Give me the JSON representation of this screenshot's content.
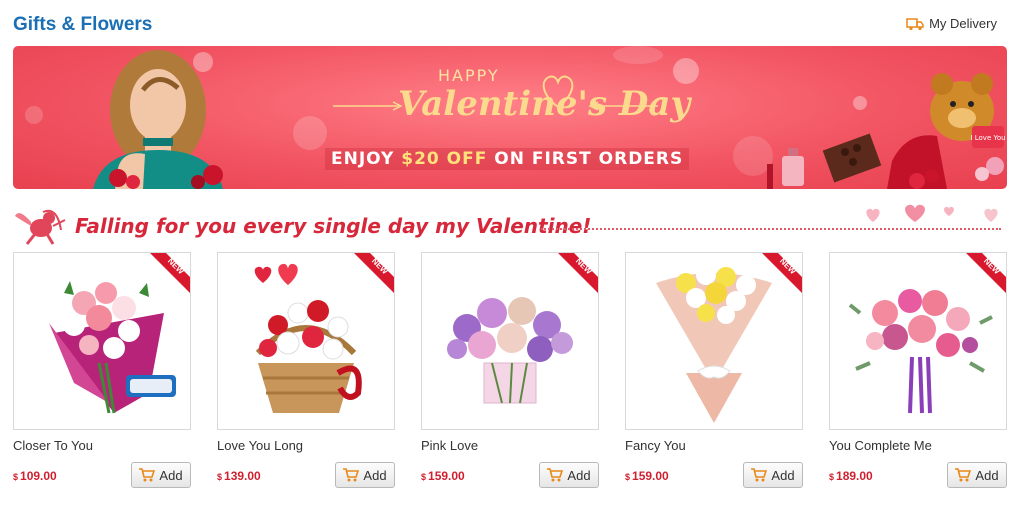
{
  "header": {
    "title": "Gifts & Flowers",
    "delivery_label": "My Delivery"
  },
  "banner": {
    "happy": "HAPPY",
    "valentines": "Valentine's Day",
    "promo_pre": "ENJOY ",
    "promo_amount": "$20 OFF",
    "promo_post": " ON FIRST ORDERS",
    "gift_box_text": "I Love You"
  },
  "tagline": {
    "text": "Falling for you every single day my Valentine!"
  },
  "ribbon_label": "NEW",
  "currency": "$",
  "add_label": "Add",
  "products": [
    {
      "name": "Closer To You",
      "price": "109.00"
    },
    {
      "name": "Love You Long",
      "price": "139.00"
    },
    {
      "name": "Pink Love",
      "price": "159.00"
    },
    {
      "name": "Fancy You",
      "price": "159.00"
    },
    {
      "name": "You Complete Me",
      "price": "189.00"
    }
  ],
  "colors": {
    "title": "#1a6fb5",
    "price": "#d0202f",
    "banner": "#f25563",
    "tagline": "#d7283b"
  },
  "icons": {
    "delivery": "truck-icon",
    "cart": "cart-icon",
    "cupid": "cupid-icon"
  }
}
